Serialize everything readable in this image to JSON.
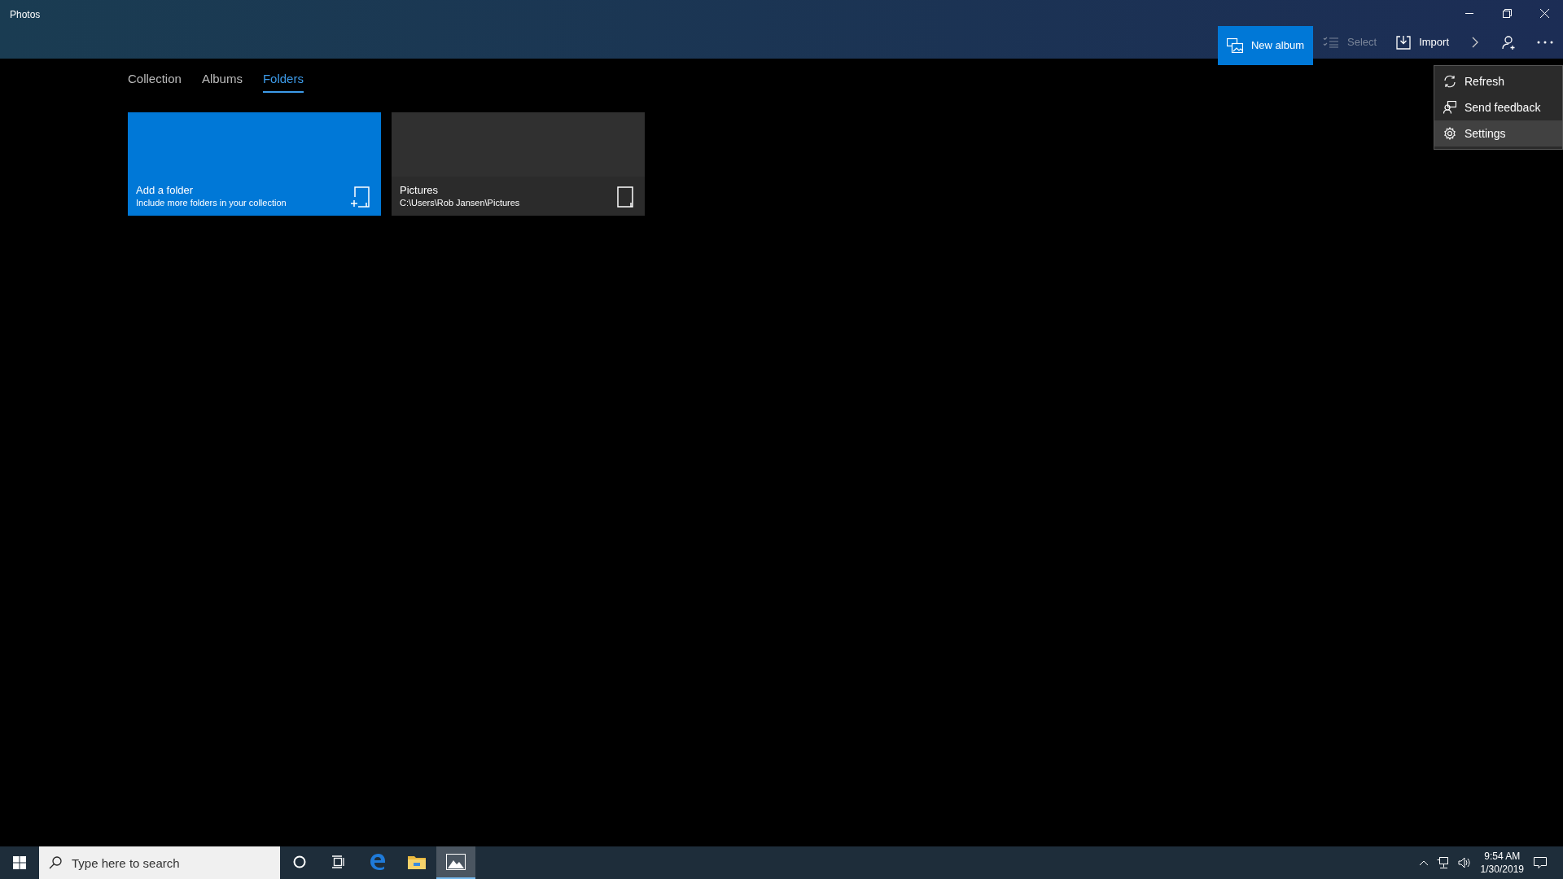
{
  "window": {
    "title": "Photos"
  },
  "toolbar": [
    {
      "kind": "new-album",
      "label": "New album",
      "disabled": false,
      "primary": true
    },
    {
      "kind": "select",
      "label": "Select",
      "disabled": true,
      "primary": false
    },
    {
      "kind": "import",
      "label": "Import",
      "disabled": false,
      "primary": false
    }
  ],
  "tabs": [
    {
      "label": "Collection",
      "selected": false
    },
    {
      "label": "Albums",
      "selected": false
    },
    {
      "label": "Folders",
      "selected": true
    }
  ],
  "folders": [
    {
      "kind": "add",
      "title": "Add a folder",
      "subtitle": "Include more folders in your collection"
    },
    {
      "kind": "folder",
      "title": "Pictures",
      "subtitle": "C:\\Users\\Rob Jansen\\Pictures"
    }
  ],
  "menu": [
    {
      "kind": "refresh",
      "label": "Refresh",
      "selected": false
    },
    {
      "kind": "feedback",
      "label": "Send feedback",
      "selected": false
    },
    {
      "kind": "settings",
      "label": "Settings",
      "selected": true
    }
  ],
  "taskbar": {
    "search": {
      "placeholder": "Type here to search"
    },
    "apps": [
      {
        "kind": "cortana",
        "active": false
      },
      {
        "kind": "task-view",
        "active": false
      },
      {
        "kind": "edge",
        "active": false
      },
      {
        "kind": "explorer",
        "active": false
      },
      {
        "kind": "photos",
        "active": true
      }
    ],
    "time": "9:54 AM",
    "date": "1/30/2019"
  }
}
